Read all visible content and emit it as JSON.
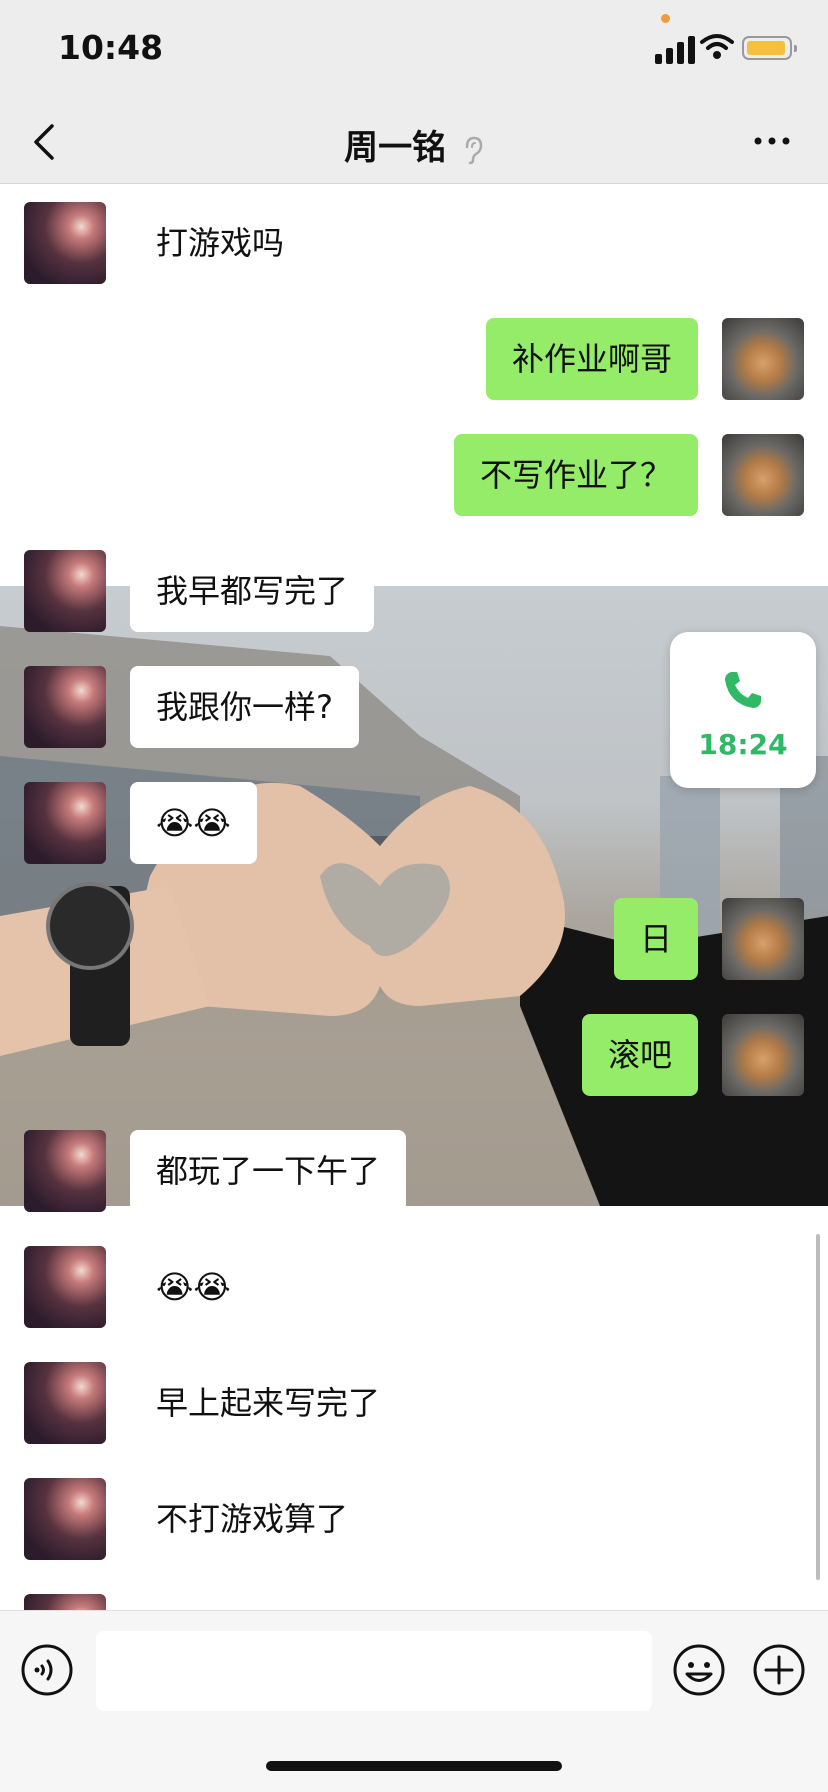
{
  "status_bar": {
    "time": "10:48"
  },
  "header": {
    "title": "周一铭"
  },
  "messages": [
    {
      "side": "friend",
      "text": "打游戏吗"
    },
    {
      "side": "me",
      "text": "补作业啊哥"
    },
    {
      "side": "me",
      "text": "不写作业了？"
    },
    {
      "side": "friend",
      "text": "我早都写完了"
    },
    {
      "side": "friend",
      "text": "我跟你一样?"
    },
    {
      "side": "friend",
      "text": "😭😭"
    },
    {
      "side": "me",
      "text": "日"
    },
    {
      "side": "me",
      "text": "滚吧"
    },
    {
      "side": "friend",
      "text": "都玩了一下午了"
    },
    {
      "side": "friend",
      "text": "😭😭"
    },
    {
      "side": "friend",
      "text": "早上起来写完了"
    },
    {
      "side": "friend",
      "text": "不打游戏算了"
    }
  ],
  "call_card": {
    "time": "18:24",
    "icon": "phone-icon"
  },
  "colors": {
    "my_bubble": "#95ec69",
    "call_green": "#2fb866",
    "bar_bg": "#ededed"
  }
}
